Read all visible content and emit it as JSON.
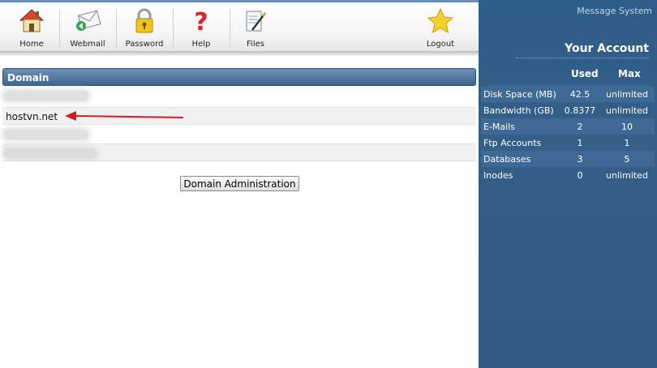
{
  "toolbar": {
    "items": [
      {
        "label": "Home",
        "icon": "home-icon"
      },
      {
        "label": "Webmail",
        "icon": "webmail-icon"
      },
      {
        "label": "Password",
        "icon": "lock-icon"
      },
      {
        "label": "Help",
        "icon": "question-icon"
      },
      {
        "label": "Files",
        "icon": "files-icon"
      },
      {
        "label": "Logout",
        "icon": "star-icon"
      }
    ]
  },
  "domain_list": {
    "header": "Domain",
    "rows": [
      {
        "name": "",
        "blurred": true
      },
      {
        "name": "hostvn.net",
        "blurred": false,
        "annotated": true
      },
      {
        "name": "",
        "blurred": true
      },
      {
        "name": "",
        "blurred": true
      }
    ],
    "annotation_color": "#d91c1c"
  },
  "actions": {
    "domain_admin_label": "Domain Administration"
  },
  "side_panel": {
    "message_system": "Message System",
    "title": "Your Account",
    "columns": {
      "used": "Used",
      "max": "Max"
    },
    "stats": [
      {
        "name": "Disk Space (MB)",
        "used": "42.5",
        "max": "unlimited"
      },
      {
        "name": "Bandwidth (GB)",
        "used": "0.8377",
        "max": "unlimited"
      },
      {
        "name": "E-Mails",
        "used": "2",
        "max": "10"
      },
      {
        "name": "Ftp Accounts",
        "used": "1",
        "max": "1"
      },
      {
        "name": "Databases",
        "used": "3",
        "max": "5"
      },
      {
        "name": "Inodes",
        "used": "0",
        "max": "unlimited"
      }
    ],
    "colors": {
      "panel": "#2f5b84",
      "accent": "#4a74a2"
    }
  }
}
